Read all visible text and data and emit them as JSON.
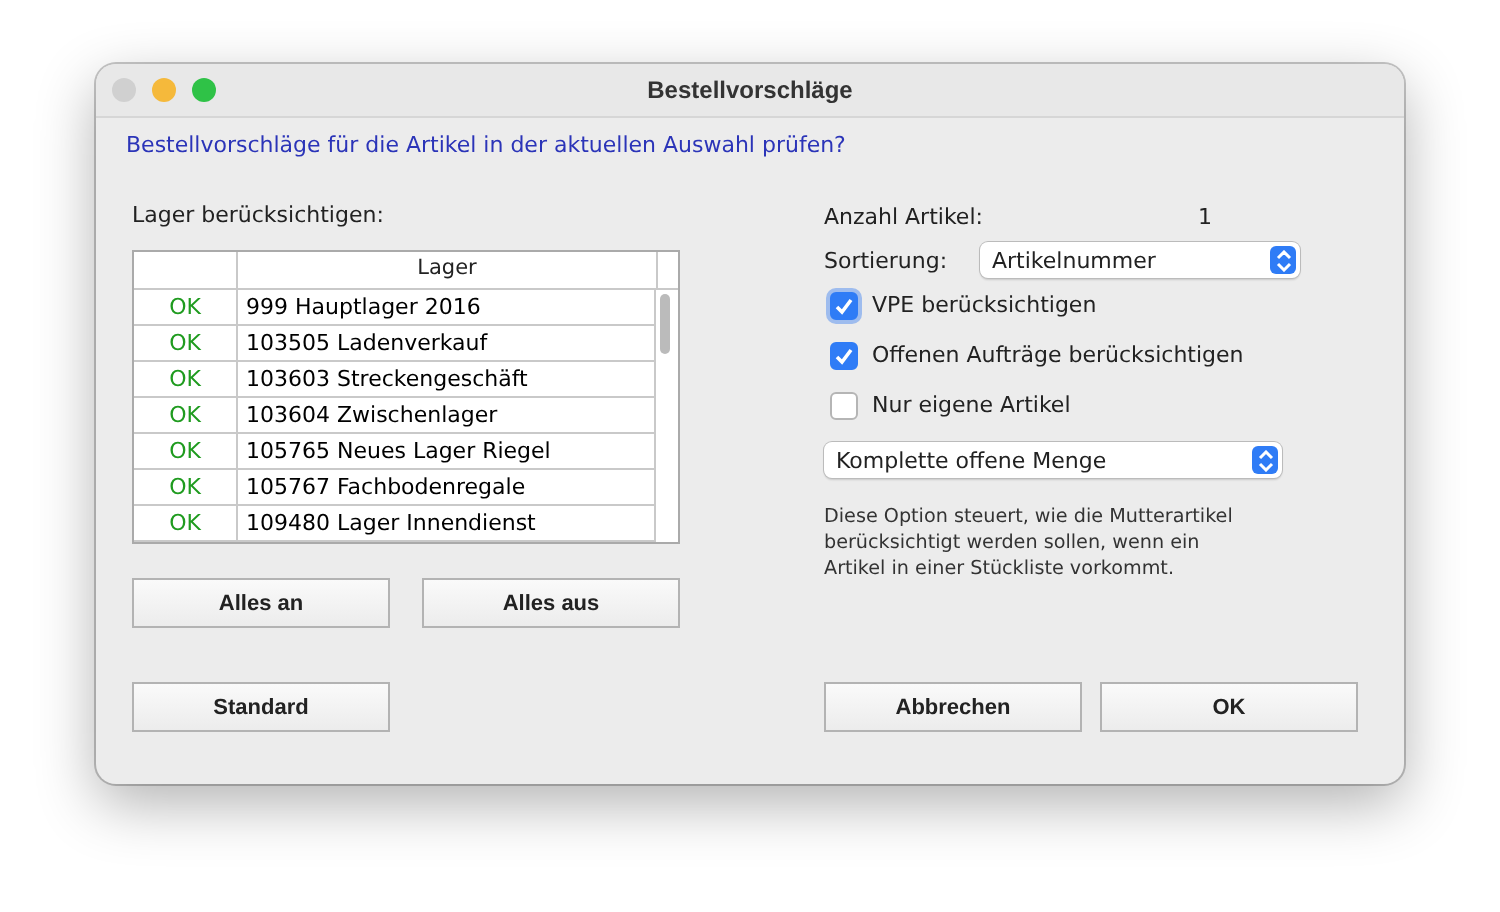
{
  "window": {
    "title": "Bestellvorschläge"
  },
  "prompt": "Bestellvorschläge für die Artikel in der aktuellen Auswahl prüfen?",
  "lager": {
    "label": "Lager berücksichtigen:",
    "columns": [
      "",
      "Lager"
    ],
    "rows": [
      {
        "status": "OK",
        "name": "999 Hauptlager 2016"
      },
      {
        "status": "OK",
        "name": "103505 Ladenverkauf"
      },
      {
        "status": "OK",
        "name": "103603 Streckengeschäft"
      },
      {
        "status": "OK",
        "name": "103604 Zwischenlager"
      },
      {
        "status": "OK",
        "name": "105765 Neues Lager Riegel"
      },
      {
        "status": "OK",
        "name": "105767 Fachbodenregale"
      },
      {
        "status": "OK",
        "name": "109480 Lager Innendienst"
      }
    ],
    "buttons": [
      "Alles an",
      "Alles aus"
    ]
  },
  "anzahl": {
    "label": "Anzahl Artikel:",
    "value": "1"
  },
  "sortierung": {
    "label": "Sortierung:",
    "value": "Artikelnummer"
  },
  "checkboxes": [
    {
      "label": "VPE berücksichtigen",
      "checked": true,
      "focused": true
    },
    {
      "label": "Offenen Aufträge berücksichtigen",
      "checked": true,
      "focused": false
    },
    {
      "label": "Nur eigene Artikel",
      "checked": false,
      "focused": false
    }
  ],
  "menge": {
    "value": "Komplette offene Menge"
  },
  "description": "Diese Option steuert, wie die Mutterartikel berücksichtigt werden sollen, wenn ein Artikel in einer Stückliste vorkommt.",
  "footer": {
    "left": [
      "Standard"
    ],
    "right": [
      "Abbrechen",
      "OK"
    ]
  }
}
